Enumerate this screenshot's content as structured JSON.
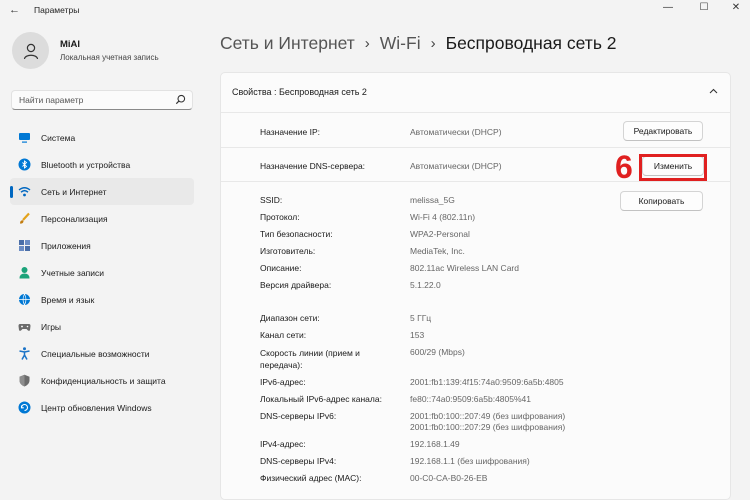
{
  "window": {
    "title": "Параметры",
    "back_glyph": "←",
    "minimize_glyph": "—",
    "maximize_glyph": "☐",
    "close_glyph": "✕"
  },
  "user": {
    "name": "MiAl",
    "account": "Локальная учетная запись"
  },
  "search": {
    "placeholder": "Найти параметр"
  },
  "sidebar": {
    "items": [
      {
        "label": "Система",
        "icon": "monitor-icon",
        "color": "#0078d4"
      },
      {
        "label": "Bluetooth и устройства",
        "icon": "bluetooth-icon",
        "color": "#0078d4"
      },
      {
        "label": "Сеть и Интернет",
        "icon": "wifi-icon",
        "color": "#0067c0",
        "active": true
      },
      {
        "label": "Персонализация",
        "icon": "brush-icon",
        "color": "#e3a21a"
      },
      {
        "label": "Приложения",
        "icon": "apps-icon",
        "color": "#4a6ea8"
      },
      {
        "label": "Учетные записи",
        "icon": "person-icon",
        "color": "#1ba37a"
      },
      {
        "label": "Время и язык",
        "icon": "globe-icon",
        "color": "#0078d4"
      },
      {
        "label": "Игры",
        "icon": "gamepad-icon",
        "color": "#6b6b6b"
      },
      {
        "label": "Специальные возможности",
        "icon": "accessibility-icon",
        "color": "#1a73c7"
      },
      {
        "label": "Конфиденциальность и защита",
        "icon": "shield-icon",
        "color": "#6b6b6b"
      },
      {
        "label": "Центр обновления Windows",
        "icon": "update-icon",
        "color": "#0078d4"
      }
    ]
  },
  "breadcrumb": {
    "part1": "Сеть и Интернет",
    "part2": "Wi-Fi",
    "current": "Беспроводная сеть 2",
    "separator": "›"
  },
  "card": {
    "title": "Свойства : Беспроводная сеть 2"
  },
  "ip": {
    "label": "Назначение IP:",
    "value": "Автоматически (DHCP)",
    "button": "Редактировать"
  },
  "dns": {
    "label": "Назначение DNS-сервера:",
    "value": "Автоматически (DHCP)",
    "button": "Изменить",
    "step_number": "6"
  },
  "copy_button": "Копировать",
  "properties": [
    {
      "label": "SSID:",
      "value": "melissa_5G"
    },
    {
      "label": "Протокол:",
      "value": "Wi-Fi 4 (802.11n)"
    },
    {
      "label": "Тип безопасности:",
      "value": "WPA2-Personal"
    },
    {
      "label": "Изготовитель:",
      "value": "MediaTek, Inc."
    },
    {
      "label": "Описание:",
      "value": "802.11ac Wireless LAN Card"
    },
    {
      "label": "Версия драйвера:",
      "value": "5.1.22.0"
    },
    {
      "label": "Диапазон сети:",
      "value": "5 ГГц"
    },
    {
      "label": "Канал сети:",
      "value": "153"
    },
    {
      "label": "Скорость линии (прием и передача):",
      "value": "600/29 (Mbps)"
    },
    {
      "label": "IPv6-адрес:",
      "value": "2001:fb1:139:4f15:74a0:9509:6a5b:4805"
    },
    {
      "label": "Локальный IPv6-адрес канала:",
      "value": "fe80::74a0:9509:6a5b:4805%41"
    },
    {
      "label": "DNS-серверы IPv6:",
      "value": "2001:fb0:100::207:49 (без шифрования)\n2001:fb0:100::207:29 (без шифрования)"
    },
    {
      "label": "IPv4-адрес:",
      "value": "192.168.1.49"
    },
    {
      "label": "DNS-серверы IPv4:",
      "value": "192.168.1.1 (без шифрования)"
    },
    {
      "label": "Физический адрес (MAC):",
      "value": "00-C0-CA-B0-26-EB"
    }
  ],
  "colors": {
    "accent": "#0067c0",
    "annotation": "#e02020"
  }
}
